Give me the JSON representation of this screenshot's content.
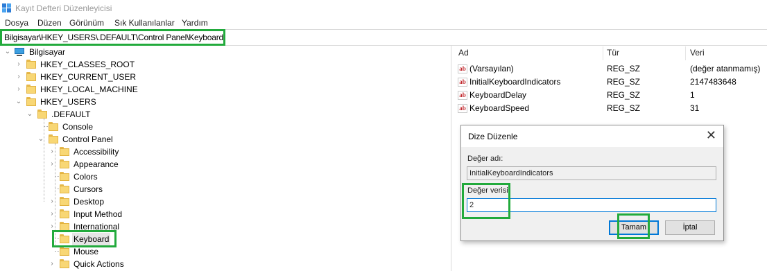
{
  "window": {
    "title": "Kayıt Defteri Düzenleyicisi"
  },
  "menu": [
    "Dosya",
    "Düzen",
    "Görünüm",
    "Sık Kullanılanlar",
    "Yardım"
  ],
  "address": "Bilgisayar\\HKEY_USERS\\.DEFAULT\\Control Panel\\Keyboard",
  "tree": {
    "root": "Bilgisayar",
    "hives": [
      "HKEY_CLASSES_ROOT",
      "HKEY_CURRENT_USER",
      "HKEY_LOCAL_MACHINE",
      "HKEY_USERS"
    ],
    "default": ".DEFAULT",
    "console": "Console",
    "control_panel": "Control Panel",
    "children": [
      "Accessibility",
      "Appearance",
      "Colors",
      "Cursors",
      "Desktop",
      "Input Method",
      "International",
      "Keyboard",
      "Mouse",
      "Quick Actions"
    ],
    "selected": "Keyboard"
  },
  "values_pane": {
    "columns": [
      "Ad",
      "Tür",
      "Veri"
    ],
    "rows": [
      {
        "name": "(Varsayılan)",
        "type": "REG_SZ",
        "data": "(değer atanmamış)"
      },
      {
        "name": "InitialKeyboardIndicators",
        "type": "REG_SZ",
        "data": "2147483648"
      },
      {
        "name": "KeyboardDelay",
        "type": "REG_SZ",
        "data": "1"
      },
      {
        "name": "KeyboardSpeed",
        "type": "REG_SZ",
        "data": "31"
      }
    ]
  },
  "dialog": {
    "title": "Dize Düzenle",
    "close": "✕",
    "name_label": "Değer adı:",
    "name_value": "InitialKeyboardIndicators",
    "data_label": "Değer verisi:",
    "data_value": "2",
    "ok": "Tamam",
    "cancel": "İptal"
  },
  "icons": {
    "string_value": "ab-icon",
    "folder": "folder-icon",
    "computer": "computer-icon",
    "app": "regedit-icon"
  },
  "colors": {
    "highlight": "#22aa3c",
    "folder": "#f8d775",
    "focus": "#0078d7"
  }
}
